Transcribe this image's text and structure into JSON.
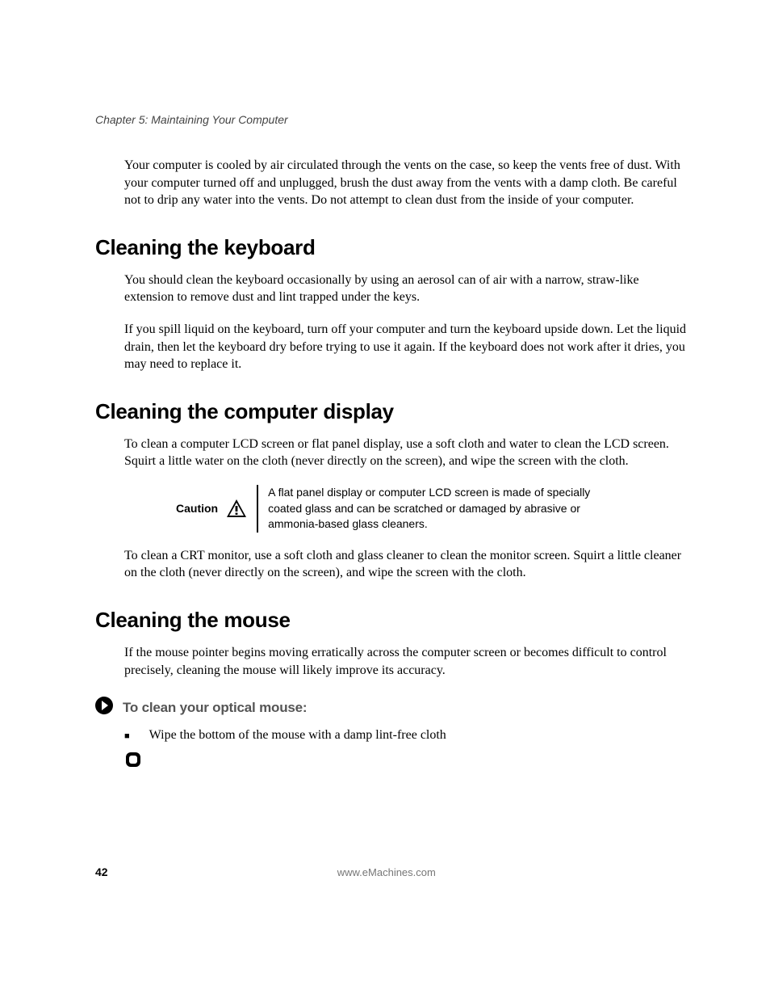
{
  "running_head": "Chapter 5: Maintaining Your Computer",
  "intro_para": "Your computer is cooled by air circulated through the vents on the case, so keep the vents free of dust. With your computer turned off and unplugged, brush the dust away from the vents with a damp cloth. Be careful not to drip any water into the vents. Do not attempt to clean dust from the inside of your computer.",
  "sections": {
    "keyboard": {
      "heading": "Cleaning the keyboard",
      "p1": "You should clean the keyboard occasionally by using an aerosol can of air with a narrow, straw-like extension to remove dust and lint trapped under the keys.",
      "p2": "If you spill liquid on the keyboard, turn off your computer and turn the keyboard upside down. Let the liquid drain, then let the keyboard dry before trying to use it again. If the keyboard does not work after it dries, you may need to replace it."
    },
    "display": {
      "heading": "Cleaning the computer display",
      "p1": "To clean a computer LCD screen or flat panel display, use a soft cloth and water to clean the LCD screen. Squirt a little water on the cloth (never directly on the screen), and wipe the screen with the cloth.",
      "caution_label": "Caution",
      "caution_text": "A flat panel display or computer LCD screen is made of specially coated glass and can be scratched or damaged by abrasive or ammonia-based glass cleaners.",
      "p2": "To clean a CRT monitor, use a soft cloth and glass cleaner to clean the monitor screen. Squirt a little cleaner on the cloth (never directly on the screen), and wipe the screen with the cloth."
    },
    "mouse": {
      "heading": "Cleaning the mouse",
      "p1": "If the mouse pointer begins moving erratically across the computer screen or becomes difficult to control precisely, cleaning the mouse will likely improve its accuracy.",
      "proc_title": "To clean your optical mouse:",
      "bullet1": "Wipe the bottom of the mouse with a damp lint-free cloth"
    }
  },
  "footer": {
    "page": "42",
    "url": "www.eMachines.com"
  }
}
